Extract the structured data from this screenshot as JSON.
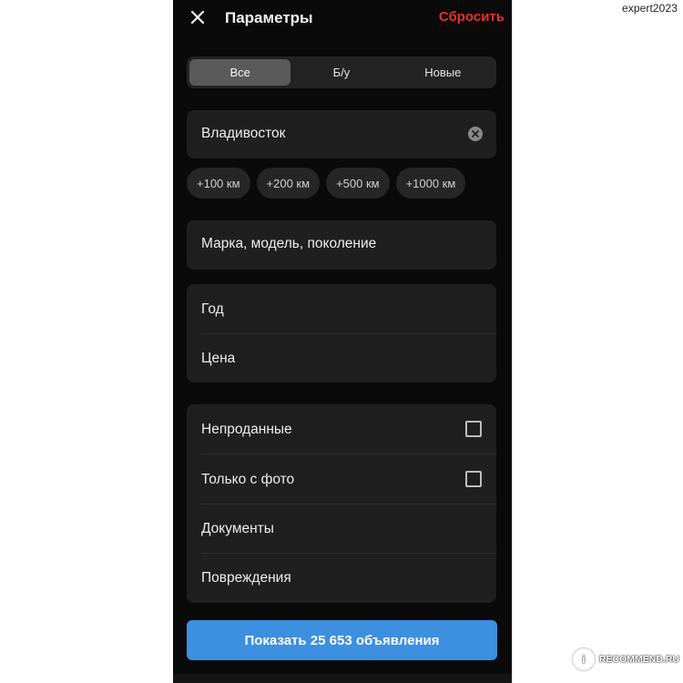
{
  "watermarks": {
    "user": "expert2023",
    "site_badge": "i",
    "site": "RECOMMEND.RU"
  },
  "header": {
    "close_icon": "close-icon",
    "title": "Параметры",
    "reset_label": "Сбросить"
  },
  "condition_tabs": {
    "items": [
      {
        "label": "Все",
        "active": true
      },
      {
        "label": "Б/у",
        "active": false
      },
      {
        "label": "Новые",
        "active": false
      }
    ]
  },
  "location": {
    "value": "Владивосток",
    "clear_icon": "clear-circle-icon"
  },
  "radius_chips": [
    "+100 км",
    "+200 км",
    "+500 км",
    "+1000 км"
  ],
  "brand_field": {
    "label": "Марка, модель, поколение"
  },
  "year_price": {
    "year_label": "Год",
    "price_label": "Цена"
  },
  "options": {
    "unsold_label": "Непроданные",
    "unsold_checked": false,
    "photo_label": "Только с фото",
    "photo_checked": false,
    "documents_label": "Документы",
    "damage_label": "Повреждения"
  },
  "submit": {
    "label": "Показать 25 653 объявления"
  },
  "colors": {
    "background": "#0a0a0a",
    "card": "#1f1f1f",
    "accent_red": "#e8302c",
    "accent_blue": "#3d8fe0"
  }
}
